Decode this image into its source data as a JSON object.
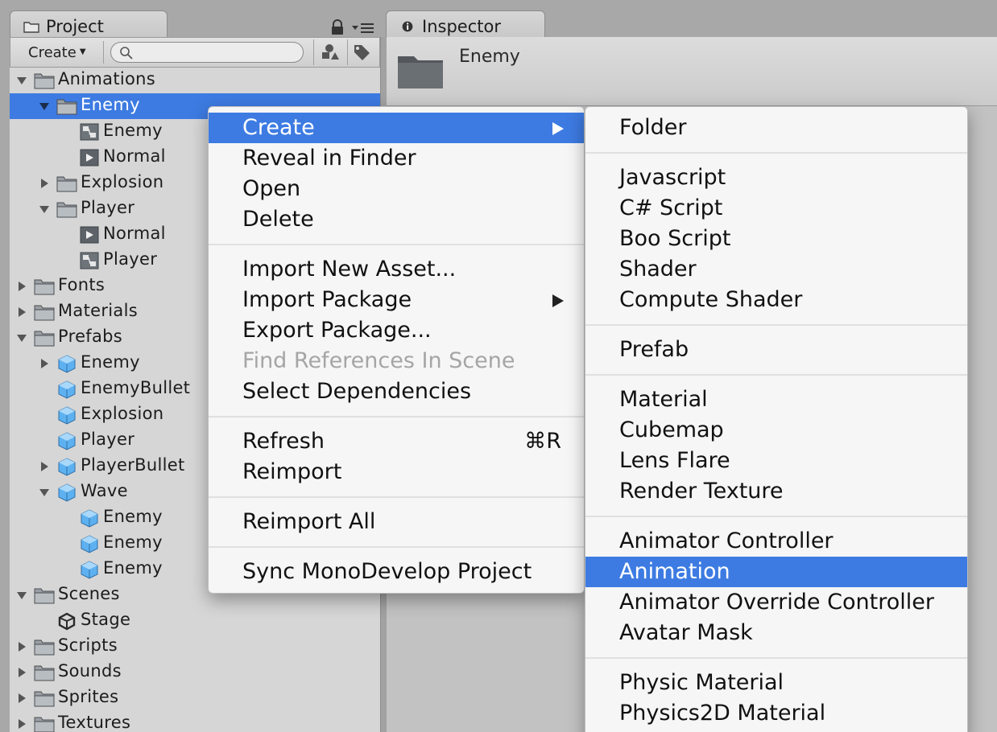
{
  "project_panel": {
    "tab_label": "Project",
    "toolbar": {
      "create_label": "Create",
      "search_placeholder": ""
    },
    "tree": [
      {
        "label": "Animations",
        "icon": "folder-icon",
        "depth": 0,
        "arrow": "expanded"
      },
      {
        "label": "Enemy",
        "icon": "folder-icon",
        "depth": 1,
        "arrow": "expanded",
        "selected": true
      },
      {
        "label": "Enemy",
        "icon": "animator-controller-icon",
        "depth": 2,
        "arrow": "none"
      },
      {
        "label": "Normal",
        "icon": "animation-clip-icon",
        "depth": 2,
        "arrow": "none"
      },
      {
        "label": "Explosion",
        "icon": "folder-icon",
        "depth": 1,
        "arrow": "collapsed"
      },
      {
        "label": "Player",
        "icon": "folder-icon",
        "depth": 1,
        "arrow": "expanded"
      },
      {
        "label": "Normal",
        "icon": "animation-clip-icon",
        "depth": 2,
        "arrow": "none"
      },
      {
        "label": "Player",
        "icon": "animator-controller-icon",
        "depth": 2,
        "arrow": "none"
      },
      {
        "label": "Fonts",
        "icon": "folder-icon",
        "depth": 0,
        "arrow": "collapsed"
      },
      {
        "label": "Materials",
        "icon": "folder-icon",
        "depth": 0,
        "arrow": "collapsed"
      },
      {
        "label": "Prefabs",
        "icon": "folder-icon",
        "depth": 0,
        "arrow": "expanded"
      },
      {
        "label": "Enemy",
        "icon": "prefab-icon",
        "depth": 1,
        "arrow": "collapsed"
      },
      {
        "label": "EnemyBullet",
        "icon": "prefab-icon",
        "depth": 1,
        "arrow": "none"
      },
      {
        "label": "Explosion",
        "icon": "prefab-icon",
        "depth": 1,
        "arrow": "none"
      },
      {
        "label": "Player",
        "icon": "prefab-icon",
        "depth": 1,
        "arrow": "none"
      },
      {
        "label": "PlayerBullet",
        "icon": "prefab-icon",
        "depth": 1,
        "arrow": "collapsed"
      },
      {
        "label": "Wave",
        "icon": "prefab-icon",
        "depth": 1,
        "arrow": "expanded"
      },
      {
        "label": "Enemy",
        "icon": "prefab-icon",
        "depth": 2,
        "arrow": "none"
      },
      {
        "label": "Enemy",
        "icon": "prefab-icon",
        "depth": 2,
        "arrow": "none"
      },
      {
        "label": "Enemy",
        "icon": "prefab-icon",
        "depth": 2,
        "arrow": "none"
      },
      {
        "label": "Scenes",
        "icon": "folder-icon",
        "depth": 0,
        "arrow": "expanded"
      },
      {
        "label": "Stage",
        "icon": "unity-scene-icon",
        "depth": 1,
        "arrow": "none"
      },
      {
        "label": "Scripts",
        "icon": "folder-icon",
        "depth": 0,
        "arrow": "collapsed"
      },
      {
        "label": "Sounds",
        "icon": "folder-icon",
        "depth": 0,
        "arrow": "collapsed"
      },
      {
        "label": "Sprites",
        "icon": "folder-icon",
        "depth": 0,
        "arrow": "collapsed"
      },
      {
        "label": "Textures",
        "icon": "folder-icon",
        "depth": 0,
        "arrow": "collapsed"
      }
    ]
  },
  "inspector": {
    "tab_label": "Inspector",
    "title": "Enemy"
  },
  "context_menu": {
    "groups": [
      [
        {
          "label": "Create",
          "submenu": true,
          "highlighted": true
        },
        {
          "label": "Reveal in Finder"
        },
        {
          "label": "Open"
        },
        {
          "label": "Delete"
        }
      ],
      [
        {
          "label": "Import New Asset..."
        },
        {
          "label": "Import Package",
          "submenu": true
        },
        {
          "label": "Export Package..."
        },
        {
          "label": "Find References In Scene",
          "disabled": true
        },
        {
          "label": "Select Dependencies"
        }
      ],
      [
        {
          "label": "Refresh",
          "shortcut": "⌘R"
        },
        {
          "label": "Reimport"
        }
      ],
      [
        {
          "label": "Reimport All"
        }
      ],
      [
        {
          "label": "Sync MonoDevelop Project"
        }
      ]
    ]
  },
  "create_submenu": {
    "groups": [
      [
        {
          "label": "Folder"
        }
      ],
      [
        {
          "label": "Javascript"
        },
        {
          "label": "C# Script"
        },
        {
          "label": "Boo Script"
        },
        {
          "label": "Shader"
        },
        {
          "label": "Compute Shader"
        }
      ],
      [
        {
          "label": "Prefab"
        }
      ],
      [
        {
          "label": "Material"
        },
        {
          "label": "Cubemap"
        },
        {
          "label": "Lens Flare"
        },
        {
          "label": "Render Texture"
        }
      ],
      [
        {
          "label": "Animator Controller"
        },
        {
          "label": "Animation",
          "highlighted": true
        },
        {
          "label": "Animator Override Controller"
        },
        {
          "label": "Avatar Mask"
        }
      ],
      [
        {
          "label": "Physic Material"
        },
        {
          "label": "Physics2D Material"
        }
      ]
    ]
  },
  "colors": {
    "selection": "#3d7be2",
    "panel_bg": "#d6d6d6",
    "menu_bg": "#f6f6f6",
    "disabled_text": "#a5a5a5"
  }
}
